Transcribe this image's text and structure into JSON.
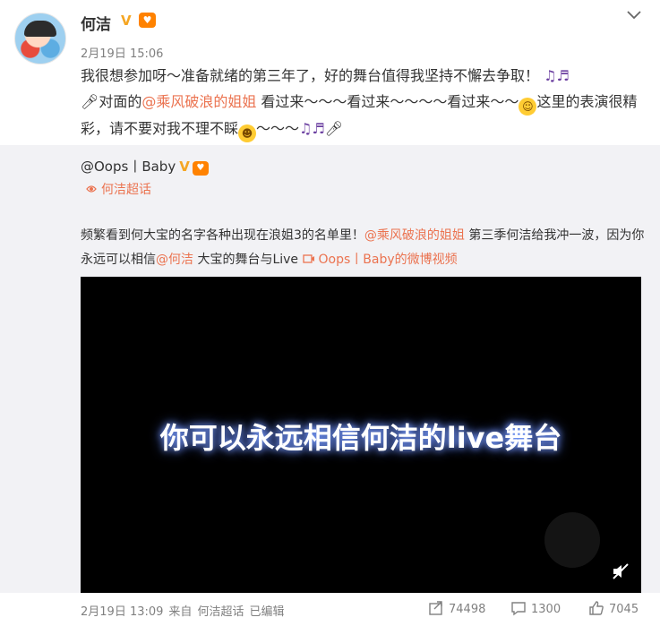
{
  "post": {
    "author": "何洁",
    "verified_badge": "V",
    "timestamp": "2月19日 15:06",
    "content": {
      "part1": "我很想参加呀～准备就绪的第三年了，好的舞台值得我坚持不懈去争取！",
      "part2": "对面的",
      "mention": "@乘风破浪的姐姐",
      "part3": " 看过来～～～看过来～～～～看过来～～",
      "part4": "这里的表演很精彩，请不要对我不理不睬",
      "part5": "～～～"
    }
  },
  "repost": {
    "author": "@Oops丨Baby",
    "verified_badge": "V",
    "topic": "何洁超话",
    "text": {
      "part1": "频繁看到何大宝的名字各种出现在浪姐3的名单里！",
      "mention1": "@乘风破浪的姐姐",
      "part2": " 第三季何洁给我冲一波，因为你永远可以相信",
      "mention2": "@何洁",
      "part3": " 大宝的舞台与Live ",
      "video_link": "Oops丨Baby的微博视频"
    },
    "video": {
      "caption": "你可以永远相信何洁的live舞台"
    }
  },
  "footer": {
    "date": "2月19日 13:09",
    "source_prefix": "来自",
    "source": "何洁超话",
    "edited": "已编辑",
    "reposts": "74498",
    "comments": "1300",
    "likes": "7045"
  },
  "icons": [
    "chevron-down-icon",
    "music-note-icon",
    "microphone-icon",
    "grin-emoji-icon",
    "laugh-cry-emoji-icon",
    "topic-icon",
    "video-link-icon",
    "mute-icon",
    "repost-icon",
    "comment-icon",
    "like-icon"
  ],
  "colors": {
    "link": "#eb7350",
    "badge": "#f5a623",
    "repost_bg": "#f2f2f5",
    "muted_text": "#808080"
  }
}
